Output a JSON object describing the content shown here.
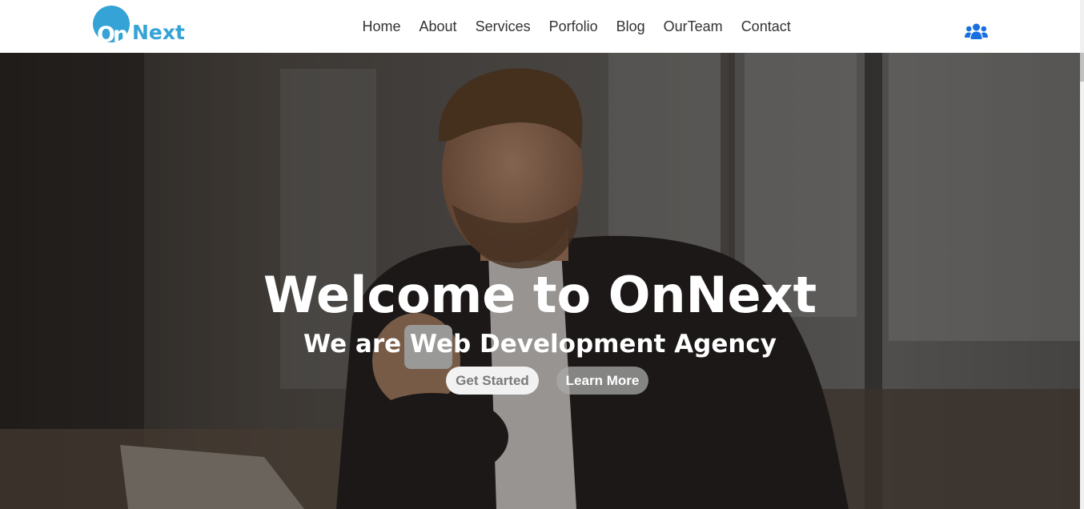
{
  "brand": {
    "logo_on": "On",
    "logo_next": "Next"
  },
  "nav": {
    "items": [
      {
        "label": "Home"
      },
      {
        "label": "About"
      },
      {
        "label": "Services"
      },
      {
        "label": "Porfolio"
      },
      {
        "label": "Blog"
      },
      {
        "label": "OurTeam"
      },
      {
        "label": "Contact"
      }
    ],
    "team_icon": "users-icon"
  },
  "hero": {
    "title": "Welcome to OnNext",
    "subtitle": "We are Web Development Agency",
    "primary_button": "Get Started",
    "secondary_button": "Learn More",
    "background_image": "smiling-man-with-coffee"
  },
  "colors": {
    "brand": "#35a3d6",
    "team_icon": "#1a6fe0",
    "nav_text": "#333333",
    "hero_text": "#ffffff"
  }
}
